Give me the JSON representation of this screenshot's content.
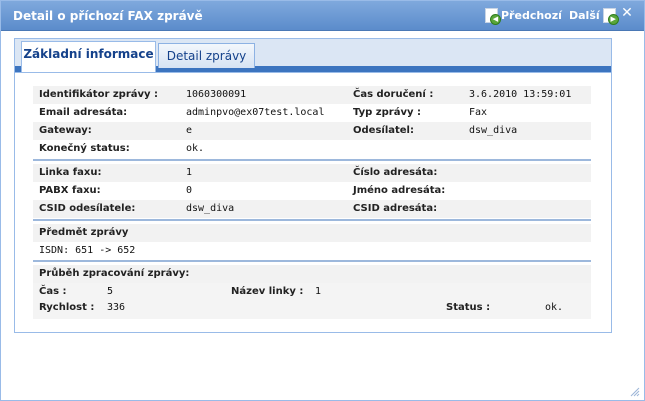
{
  "window": {
    "title": "Detail o příchozí FAX zprávě",
    "prev_label": "Předchozí",
    "next_label": "Další"
  },
  "tabs": [
    {
      "label": "Základní informace",
      "active": true
    },
    {
      "label": "Detail zprávy",
      "active": false
    }
  ],
  "fields": {
    "message_id_label": "Identifikátor zprávy :",
    "message_id_value": "1060300091",
    "delivery_time_label": "Čas doručení :",
    "delivery_time_value": "3.6.2010 13:59:01",
    "recipient_email_label": "Email adresáta:",
    "recipient_email_value": "adminpvo@ex07test.local",
    "message_type_label": "Typ zprávy :",
    "message_type_value": "Fax",
    "gateway_label": "Gateway:",
    "gateway_value": "e",
    "sender_label": "Odesílatel:",
    "sender_value": "dsw_diva",
    "final_status_label": "Konečný status:",
    "final_status_value": "ok.",
    "fax_line_label": "Linka faxu:",
    "fax_line_value": "1",
    "recipient_number_label": "Číslo adresáta:",
    "recipient_number_value": "",
    "pabx_label": "PABX faxu:",
    "pabx_value": "0",
    "recipient_name_label": "Jméno adresáta:",
    "recipient_name_value": "",
    "sender_csid_label": "CSID odesílatele:",
    "sender_csid_value": "dsw_diva",
    "recipient_csid_label": "CSID adresáta:",
    "recipient_csid_value": "",
    "subject_label": "Předmět zprávy",
    "subject_value": "ISDN: 651 -> 652",
    "processing_label": "Průběh zpracování zprávy:",
    "time_label": "Čas :",
    "time_value": "5",
    "line_name_label": "Název linky :",
    "line_name_value": "1",
    "speed_label": "Rychlost :",
    "speed_value": "336",
    "status_label": "Status :",
    "status_value": "ok."
  },
  "colors": {
    "title_bar": "#5b8ccb",
    "tab_blue": "#3c74bf",
    "row_gray": "#f2f2f2"
  }
}
